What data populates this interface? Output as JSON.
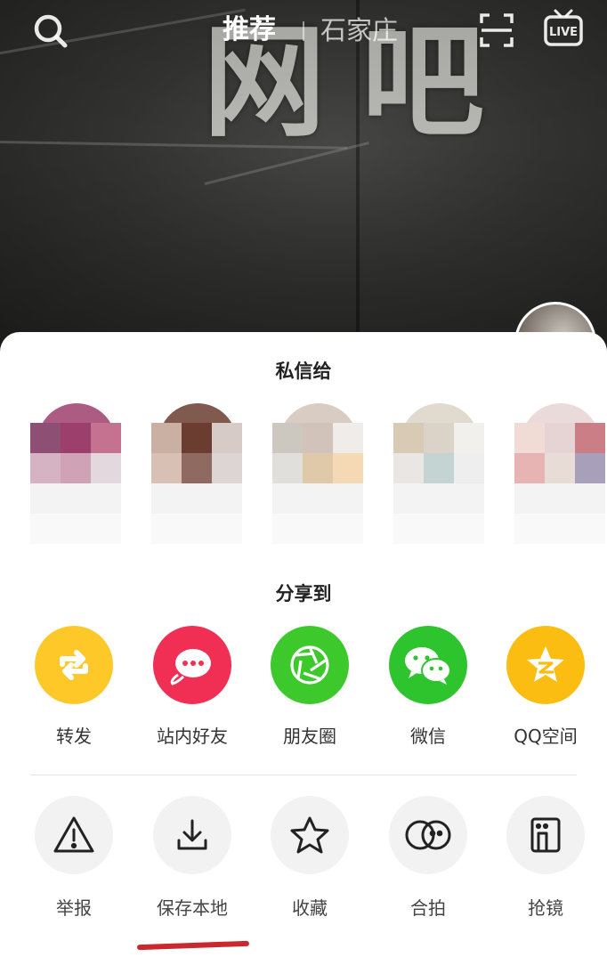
{
  "top_nav": {
    "tab_recommend": "推荐",
    "tab_city": "石家庄",
    "live_label": "LIVE",
    "icons": [
      "search-icon",
      "scan-icon",
      "live-tv-icon"
    ]
  },
  "video": {
    "sign_text": "网吧"
  },
  "direct_message": {
    "title": "私信给",
    "contacts": [
      {
        "colors": [
          "#8d4f74",
          "#9d3f6c",
          "#c4728f",
          "#d6b3c3",
          "#cfa2b6",
          "#e2d8dd"
        ]
      },
      {
        "colors": [
          "#c9b0a3",
          "#6b3d30",
          "#d6cbc7",
          "#d8c0b5",
          "#8e6a60",
          "#dcd5d4"
        ]
      },
      {
        "colors": [
          "#cdc8bf",
          "#d1c3b9",
          "#f0ece9",
          "#e0dfdc",
          "#e0c9a8",
          "#f4d9b4"
        ]
      },
      {
        "colors": [
          "#d8cab4",
          "#dbd3c7",
          "#f2f0ec",
          "#e9e6e3",
          "#c3d4d3",
          "#eeeeee"
        ]
      },
      {
        "colors": [
          "#f0dcd4",
          "#e6d3d3",
          "#cc7e86",
          "#e8b4b3",
          "#e8dcd6",
          "#a8a0bb"
        ]
      }
    ]
  },
  "share": {
    "title": "分享到",
    "items": [
      {
        "label": "转发",
        "icon": "forward-icon",
        "color": "#fdc828"
      },
      {
        "label": "站内好友",
        "icon": "chat-bubble-icon",
        "color": "#f12f55"
      },
      {
        "label": "朋友圈",
        "icon": "moments-aperture-icon",
        "color": "#3dc92c"
      },
      {
        "label": "微信",
        "icon": "wechat-icon",
        "color": "#2ec42e"
      },
      {
        "label": "QQ空间",
        "icon": "qzone-star-icon",
        "color": "#fcbd12"
      }
    ]
  },
  "actions": {
    "items": [
      {
        "label": "举报",
        "icon": "warning-icon"
      },
      {
        "label": "保存本地",
        "icon": "download-icon"
      },
      {
        "label": "收藏",
        "icon": "star-icon"
      },
      {
        "label": "合拍",
        "icon": "duet-icon"
      },
      {
        "label": "抢镜",
        "icon": "phone-mirror-icon"
      }
    ]
  },
  "colors": {
    "highlight_underline": "#c8282e",
    "action_circle": "#f2f2f2"
  }
}
